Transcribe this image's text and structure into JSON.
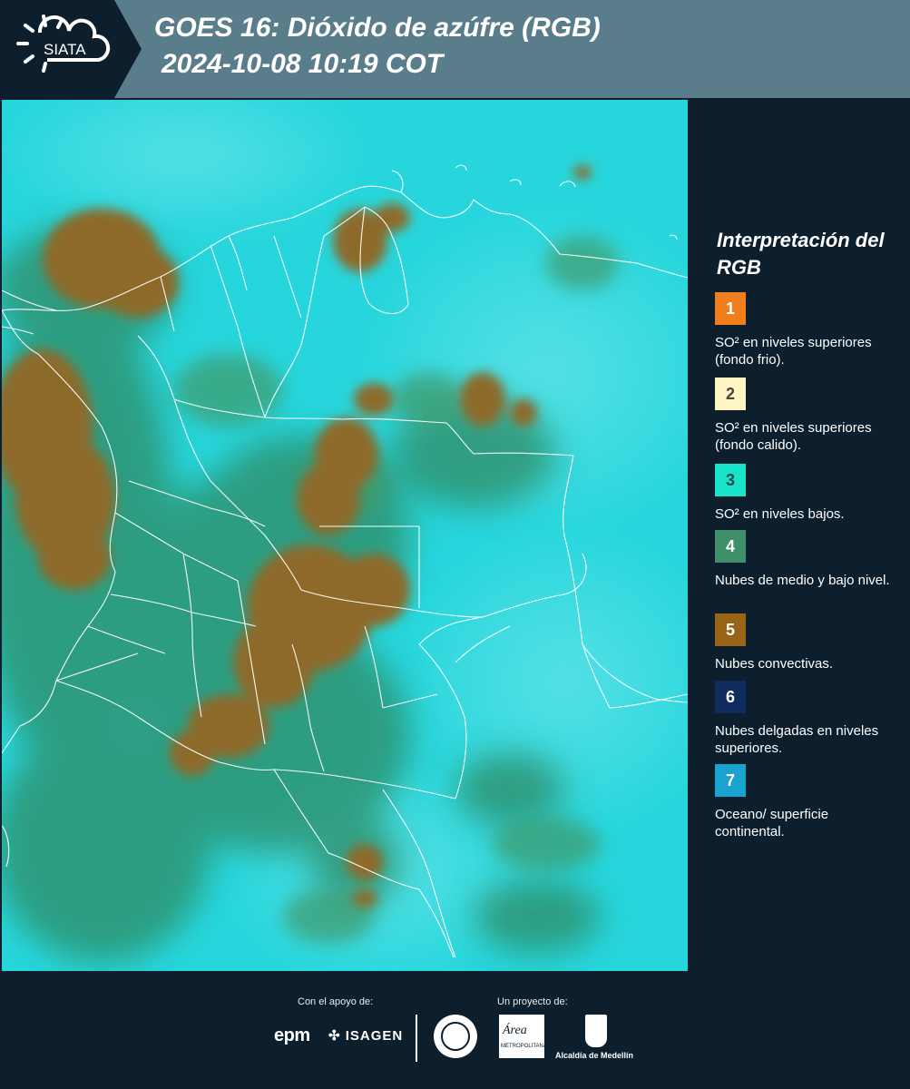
{
  "header": {
    "logo_text": "SIATA",
    "title_line1": "GOES 16: Dióxido de azúfre (RGB)",
    "title_line2": "2024-10-08 10:19 COT"
  },
  "legend": {
    "title": "Interpretación del RGB",
    "items": [
      {
        "number": "1",
        "label": "SO² en niveles superiores (fondo frio).",
        "color": "#f07e1c",
        "text_color": "#ffffff"
      },
      {
        "number": "2",
        "label": "SO² en niveles superiores (fondo calido).",
        "color": "#fff5c4",
        "text_color": "#444444"
      },
      {
        "number": "3",
        "label": "SO² en niveles bajos.",
        "color": "#19e3c8",
        "text_color": "#1a4b4a"
      },
      {
        "number": "4",
        "label": "Nubes de medio y bajo nivel.",
        "color": "#3f8f6b",
        "text_color": "#ffffff"
      },
      {
        "number": "5",
        "label": "Nubes convectivas.",
        "color": "#9a6418",
        "text_color": "#ffffff"
      },
      {
        "number": "6",
        "label": "Nubes delgadas en niveles superiores.",
        "color": "#0e2c5e",
        "text_color": "#ffffff"
      },
      {
        "number": "7",
        "label": "Oceano/ superficie continental.",
        "color": "#1aa3cf",
        "text_color": "#ffffff"
      }
    ]
  },
  "footer": {
    "support_label": "Con el apoyo de:",
    "project_label": "Un proyecto de:",
    "epm": "epm",
    "isagen": "ISAGEN",
    "area_logo": "Área",
    "area_sub": "METROPOLITANA",
    "alcaldia": "Alcaldía de Medellín"
  },
  "colors": {
    "background": "#0d1f2d",
    "header_band": "#5a7d8c",
    "map_base": "#27d6dc",
    "cloud_low": "#2e8a64",
    "cloud_convective": "#8d6a2c",
    "borders": "#ffffff"
  }
}
